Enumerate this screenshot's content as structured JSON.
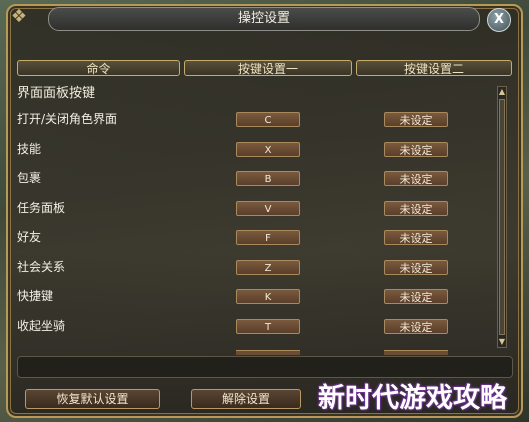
{
  "window": {
    "title": "操控设置",
    "close_label": "X"
  },
  "columns": [
    "命令",
    "按键设置一",
    "按键设置二"
  ],
  "section": "界面面板按键",
  "rows": [
    {
      "command": "打开/关闭角色界面",
      "key1": "C",
      "key2": "未设定"
    },
    {
      "command": "技能",
      "key1": "X",
      "key2": "未设定"
    },
    {
      "command": "包裹",
      "key1": "B",
      "key2": "未设定"
    },
    {
      "command": "任务面板",
      "key1": "V",
      "key2": "未设定"
    },
    {
      "command": "好友",
      "key1": "F",
      "key2": "未设定"
    },
    {
      "command": "社会关系",
      "key1": "Z",
      "key2": "未设定"
    },
    {
      "command": "快捷键",
      "key1": "K",
      "key2": "未设定"
    },
    {
      "command": "收起坐骑",
      "key1": "T",
      "key2": "未设定"
    }
  ],
  "buttons": {
    "restore_default": "恢复默认设置",
    "unbind": "解除设置"
  },
  "watermark": "新时代游戏攻略"
}
